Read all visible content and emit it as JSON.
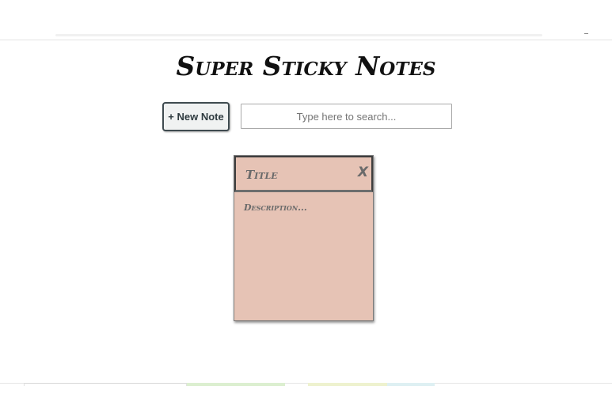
{
  "app": {
    "title": "Super Sticky Notes"
  },
  "toolbar": {
    "new_note_label": "+ New Note",
    "search_placeholder": "Type here to search..."
  },
  "notes": [
    {
      "title": "Title",
      "close_label": "X",
      "description": "Description..."
    }
  ],
  "colors": {
    "note_background": "#e6c3b5",
    "button_background": "#f0f2f2",
    "title_text": "#111111"
  }
}
